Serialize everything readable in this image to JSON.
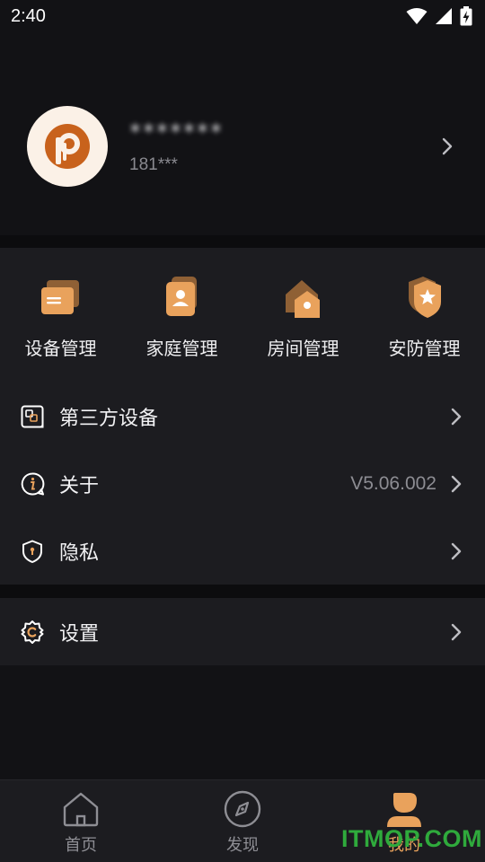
{
  "status_bar": {
    "time": "2:40",
    "icons": [
      "wifi-icon",
      "cell-signal-icon",
      "battery-charging-icon"
    ]
  },
  "profile": {
    "name": "*******",
    "phone": "181***",
    "avatar_icon": "brand-p-logo-icon"
  },
  "quick_actions": [
    {
      "label": "设备管理",
      "icon": "device-cards-icon"
    },
    {
      "label": "家庭管理",
      "icon": "family-member-icon"
    },
    {
      "label": "房间管理",
      "icon": "room-house-icon"
    },
    {
      "label": "安防管理",
      "icon": "security-shield-icon"
    }
  ],
  "menu": {
    "third_party": {
      "label": "第三方设备",
      "icon": "third-party-device-icon"
    },
    "about": {
      "label": "关于",
      "value": "V5.06.002",
      "icon": "info-bubble-icon"
    },
    "privacy": {
      "label": "隐私",
      "icon": "privacy-shield-icon"
    },
    "settings": {
      "label": "设置",
      "icon": "settings-gear-icon"
    }
  },
  "tabs": [
    {
      "label": "首页",
      "icon": "home-icon",
      "active": false
    },
    {
      "label": "发现",
      "icon": "compass-icon",
      "active": false
    },
    {
      "label": "我的",
      "icon": "profile-person-icon",
      "active": true
    }
  ],
  "watermark": "ITMOP.COM",
  "colors": {
    "background": "#121215",
    "card": "#1c1c20",
    "accent": "#e9a25c",
    "avatar_bg": "#fbf1e7",
    "brand_logo": "#c8621c",
    "watermark": "#2faa3c"
  }
}
